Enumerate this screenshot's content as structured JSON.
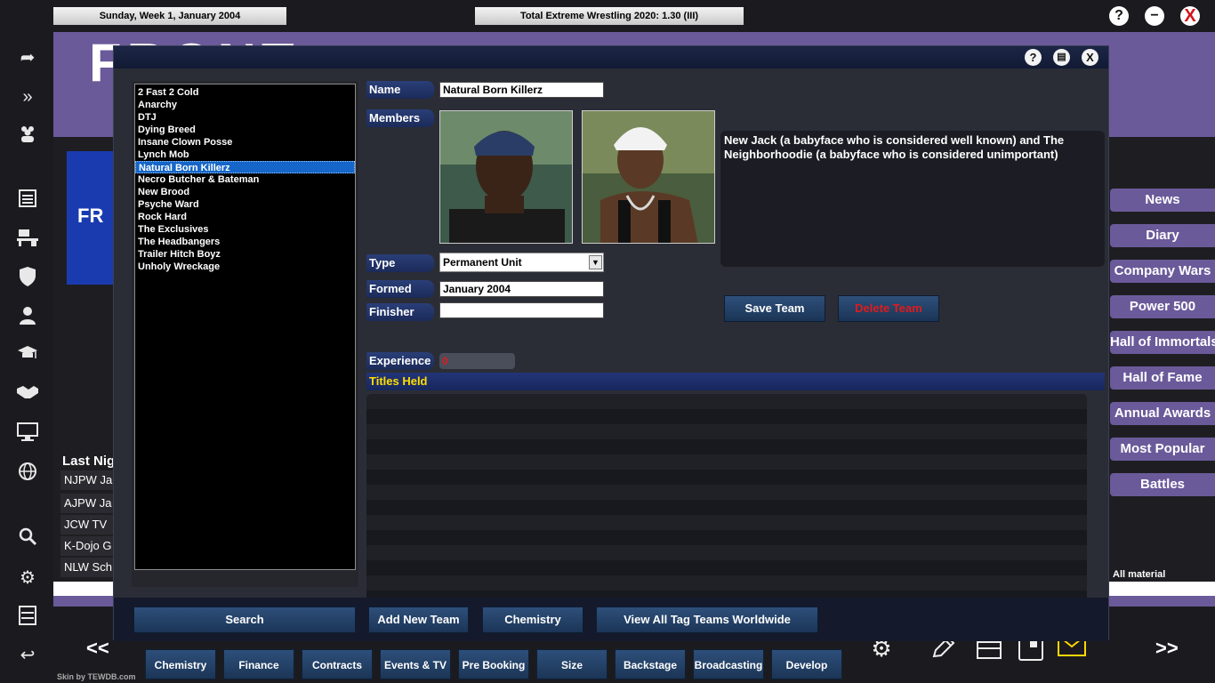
{
  "topbar": {
    "date": "Sunday, Week 1, January 2004",
    "game_title": "Total Extreme Wrestling 2020: 1.30 (III)",
    "help": "?",
    "minimize": "−",
    "close": "X"
  },
  "sidebar_icons": [
    "forward-icon",
    "fast-forward-icon",
    "people-icon",
    "news-icon",
    "desk-icon",
    "shield-icon",
    "person-icon",
    "graduation-cap-icon",
    "handshake-icon",
    "monitor-icon",
    "globe-icon",
    "search-icon",
    "gears-icon",
    "save-icon",
    "back-icon"
  ],
  "background": {
    "logo_text": "FRONT",
    "logo_box_text": "FR",
    "last_night": "Last Nigh",
    "rows": [
      "NJPW Ja",
      "AJPW Ja",
      "JCW TV",
      "K-Dojo G",
      "NLW Sch"
    ],
    "all_material": "All material"
  },
  "right_nav": [
    "News",
    "Diary",
    "Company Wars",
    "Power 500",
    "Hall of Immortals",
    "Hall of Fame",
    "Annual Awards",
    "Most Popular",
    "Battles"
  ],
  "bottom": {
    "prev": "<<",
    "next": ">>",
    "buttons": [
      "Chemistry",
      "Finance",
      "Contracts",
      "Events & TV",
      "Pre Booking",
      "Size",
      "Backstage",
      "Broadcasting",
      "Develop"
    ],
    "icons": [
      "gear-icon",
      "pencil-icon",
      "briefcase-icon",
      "notebook-icon",
      "mail-icon"
    ],
    "skin_credit": "Skin by TEWDB.com"
  },
  "dialog": {
    "title_help": "?",
    "title_save": "▤",
    "title_close": "X",
    "teams": [
      "2 Fast 2 Cold",
      "Anarchy",
      "DTJ",
      "Dying Breed",
      "Insane Clown Posse",
      "Lynch Mob",
      "Natural Born Killerz",
      "Necro Butcher & Bateman",
      "New Brood",
      "Psyche Ward",
      "Rock Hard",
      "The Exclusives",
      "The Headbangers",
      "Trailer Hitch Boyz",
      "Unholy Wreckage"
    ],
    "selected_team": "Natural Born Killerz",
    "labels": {
      "name": "Name",
      "members": "Members",
      "type": "Type",
      "formed": "Formed",
      "finisher": "Finisher",
      "experience": "Experience",
      "titles_held": "Titles Held"
    },
    "values": {
      "name": "Natural Born Killerz",
      "type": "Permanent Unit",
      "formed": "January 2004",
      "finisher": "",
      "experience": "0"
    },
    "members_description": "New Jack (a babyface who is considered well known) and The Neighborhoodie (a babyface who is considered unimportant)",
    "save_team": "Save Team",
    "delete_team": "Delete Team",
    "footer": {
      "search": "Search",
      "add_new_team": "Add New Team",
      "chemistry": "Chemistry",
      "view_all": "View All Tag Teams Worldwide"
    }
  },
  "colors": {
    "accent_purple": "#6b5a9a",
    "button_blue": "#2e4f7a",
    "titles_yellow": "#ffde00",
    "delete_red": "#e01b1b",
    "selection_blue": "#1566c8"
  }
}
